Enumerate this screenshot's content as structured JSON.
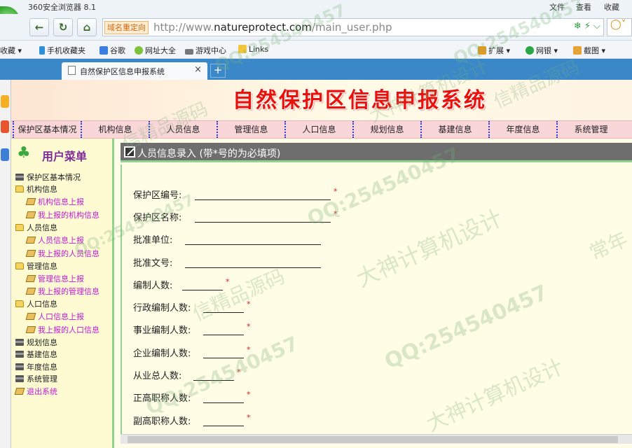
{
  "browser": {
    "title": "360安全浏览器 8.1",
    "menu": [
      "文件",
      "查看",
      "收藏"
    ],
    "address_badge": "域名重定向",
    "url": {
      "scheme": "http://www.",
      "domain": "natureprotect.com",
      "path": "/main_user.php"
    },
    "favorites": [
      "收藏",
      "手机收藏夹",
      "谷歌",
      "网址大全",
      "游戏中心",
      "Links"
    ],
    "right_tools": [
      "扩展",
      "网银",
      "截图"
    ],
    "tab_title": "自然保护区信息申报系统",
    "tab_close": "×",
    "new_tab": "+"
  },
  "site": {
    "banner_title": "自然保护区信息申报系统",
    "top_nav": [
      "保护区基本情况",
      "机构信息",
      "人员信息",
      "管理信息",
      "人口信息",
      "规划信息",
      "基建信息",
      "年度信息",
      "系统管理"
    ]
  },
  "sidebar": {
    "heading": "用户菜单",
    "items": [
      {
        "label": "保护区基本情况",
        "icon": "book-icon",
        "level": 1
      },
      {
        "label": "机构信息",
        "icon": "folder-icon",
        "level": 1
      },
      {
        "label": "机构信息上报",
        "icon": "page-icon",
        "level": 2
      },
      {
        "label": "我上报的机构信息",
        "icon": "page-icon",
        "level": 2
      },
      {
        "label": "人员信息",
        "icon": "folder-icon",
        "level": 1
      },
      {
        "label": "人员信息上报",
        "icon": "page-icon",
        "level": 2
      },
      {
        "label": "我上报的人员信息",
        "icon": "page-icon",
        "level": 2
      },
      {
        "label": "管理信息",
        "icon": "folder-icon",
        "level": 1
      },
      {
        "label": "管理信息上报",
        "icon": "page-icon",
        "level": 2
      },
      {
        "label": "我上报的管理信息",
        "icon": "page-icon",
        "level": 2
      },
      {
        "label": "人口信息",
        "icon": "folder-icon",
        "level": 1
      },
      {
        "label": "人口信息上报",
        "icon": "page-icon",
        "level": 2
      },
      {
        "label": "我上报的人口信息",
        "icon": "page-icon",
        "level": 2
      },
      {
        "label": "规划信息",
        "icon": "book-icon",
        "level": 1
      },
      {
        "label": "基建信息",
        "icon": "book-icon",
        "level": 1
      },
      {
        "label": "年度信息",
        "icon": "book-icon",
        "level": 1
      },
      {
        "label": "系统管理",
        "icon": "book-icon",
        "level": 1
      },
      {
        "label": "退出系统",
        "icon": "page-icon",
        "level": 1
      }
    ]
  },
  "form": {
    "heading": "人员信息录入 (带*号的为必填项)",
    "required_mark": "*",
    "fields": [
      {
        "label": "保护区编号:",
        "value": "",
        "required": true
      },
      {
        "label": "保护区名称:",
        "value": "",
        "required": true
      },
      {
        "label": "批准单位:",
        "value": "",
        "required": false
      },
      {
        "label": "批准文号:",
        "value": "",
        "required": false
      },
      {
        "label": "编制人数:",
        "value": "",
        "required": true
      },
      {
        "label": "行政编制人数:",
        "value": "",
        "required": true
      },
      {
        "label": "事业编制人数:",
        "value": "",
        "required": true
      },
      {
        "label": "企业编制人数:",
        "value": "",
        "required": true
      },
      {
        "label": "从业总人数:",
        "value": "",
        "required": true
      },
      {
        "label": "正高职称人数:",
        "value": "",
        "required": true
      },
      {
        "label": "副高职称人数:",
        "value": "",
        "required": true
      }
    ]
  },
  "watermarks": [
    "QQ:254540457",
    "大神计算机设计",
    "信精品源码",
    "常年"
  ]
}
